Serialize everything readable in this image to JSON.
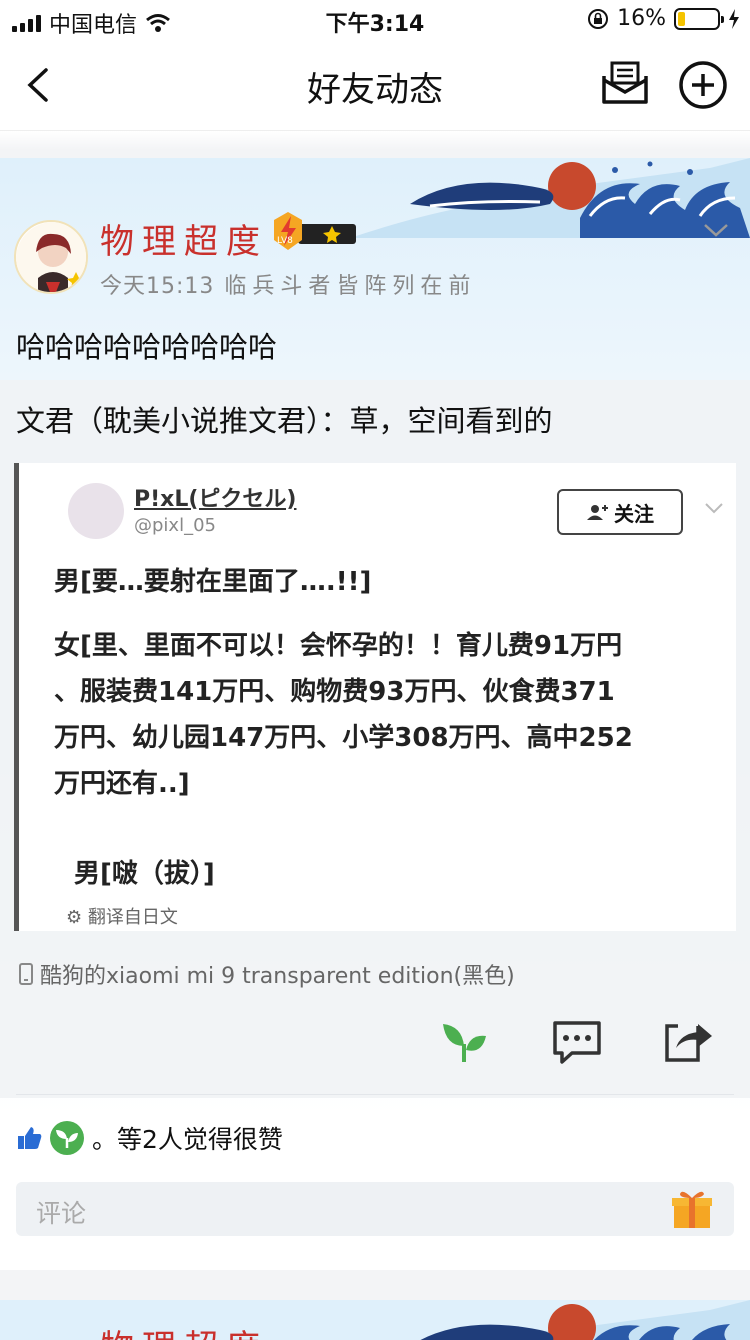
{
  "status_bar": {
    "carrier": "中国电信",
    "time": "下午3:14",
    "battery": "16%"
  },
  "nav": {
    "title": "好友动态"
  },
  "post": {
    "username": "物理超度",
    "vip_level": "LV8",
    "time": "今天15:13",
    "signature": "临兵斗者皆阵列在前",
    "text": "哈哈哈哈哈哈哈哈哈",
    "repost": {
      "text": "文君（耽美小说推文君）：草，空间看到的",
      "image": {
        "name": "P!xL(ピクセル)",
        "handle": "@pixl_05",
        "follow_label": "关注",
        "lines": [
          "男[要…要射在里面了….!!]",
          "女[里、里面不可以！会怀孕的！！育儿费91万円",
          "、服装费141万円、购物费93万円、伙食费371",
          "万円、幼儿园147万円、小学308万円、高中252",
          "万円还有..]",
          "男[啵（拔）]"
        ],
        "translate": "翻译自日文"
      }
    },
    "device": "酷狗的xiaomi mi 9 transparent edition(黑色)",
    "likes_text": "。等2人觉得很赞",
    "comment_placeholder": "评论"
  },
  "next_post": {
    "username": "物理超度"
  }
}
